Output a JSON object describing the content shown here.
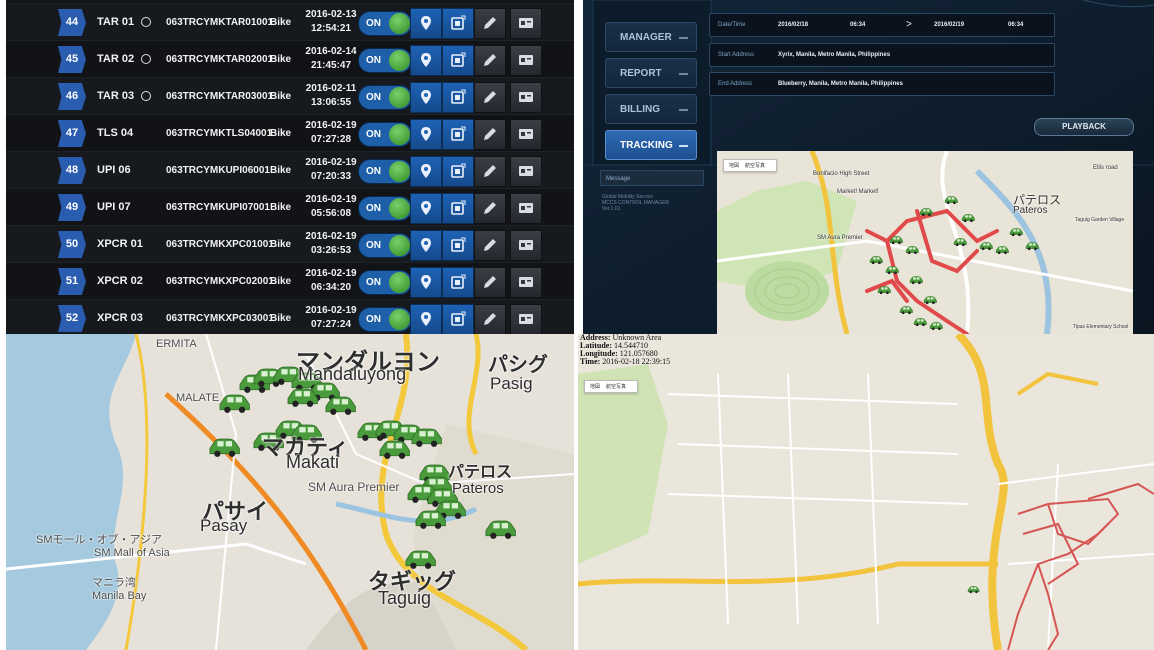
{
  "table": {
    "rows": [
      {
        "index": "44",
        "code": "TAR 01",
        "has_circle": true,
        "imei": "063TRCYMKTAR01001",
        "type": "Bike",
        "date": "2016-02-13",
        "time": "12:54:21",
        "status": "ON"
      },
      {
        "index": "45",
        "code": "TAR 02",
        "has_circle": true,
        "imei": "063TRCYMKTAR02001",
        "type": "Bike",
        "date": "2016-02-14",
        "time": "21:45:47",
        "status": "ON"
      },
      {
        "index": "46",
        "code": "TAR 03",
        "has_circle": true,
        "imei": "063TRCYMKTAR03001",
        "type": "Bike",
        "date": "2016-02-11",
        "time": "13:06:55",
        "status": "ON"
      },
      {
        "index": "47",
        "code": "TLS 04",
        "has_circle": false,
        "imei": "063TRCYMKTLS04001",
        "type": "Bike",
        "date": "2016-02-19",
        "time": "07:27:28",
        "status": "ON"
      },
      {
        "index": "48",
        "code": "UPI 06",
        "has_circle": false,
        "imei": "063TRCYMKUPI06001",
        "type": "Bike",
        "date": "2016-02-19",
        "time": "07:20:33",
        "status": "ON"
      },
      {
        "index": "49",
        "code": "UPI 07",
        "has_circle": false,
        "imei": "063TRCYMKUPI07001",
        "type": "Bike",
        "date": "2016-02-19",
        "time": "05:56:08",
        "status": "ON"
      },
      {
        "index": "50",
        "code": "XPCR 01",
        "has_circle": false,
        "imei": "063TRCYMKXPC01001",
        "type": "Bike",
        "date": "2016-02-19",
        "time": "03:26:53",
        "status": "ON"
      },
      {
        "index": "51",
        "code": "XPCR 02",
        "has_circle": false,
        "imei": "063TRCYMKXPC02001",
        "type": "Bike",
        "date": "2016-02-19",
        "time": "06:34:20",
        "status": "ON"
      },
      {
        "index": "52",
        "code": "XPCR 03",
        "has_circle": false,
        "imei": "063TRCYMKXPC03001",
        "type": "Bike",
        "date": "2016-02-19",
        "time": "07:27:24",
        "status": "ON"
      }
    ],
    "action_icons": [
      "location-pin-icon",
      "device-icon",
      "edit-pencil-icon",
      "card-icon"
    ],
    "colors": {
      "accent": "#2a5db0",
      "toggle_on": "#1d5fa8",
      "knob": "#3da52f"
    }
  },
  "dashboard": {
    "nav": [
      {
        "label": "MANAGER",
        "active": false
      },
      {
        "label": "REPORT",
        "active": false
      },
      {
        "label": "BILLING",
        "active": false
      },
      {
        "label": "TRACKING",
        "active": true
      }
    ],
    "filter": {
      "datetime_label": "Date/Time",
      "from_date": "2016/02/18",
      "from_time": "06:34",
      "arrow": ">",
      "to_date": "2016/02/19",
      "to_time": "06:34",
      "start_label": "Start Address",
      "start_value": "Xyrix, Manila, Metro Manila, Philippines",
      "end_label": "End Address",
      "end_value": "Blueberry, Manila, Metro Manila, Philippines"
    },
    "playback_label": "PLAYBACK",
    "message_label": "Message",
    "message_text": "Global Mobility Service\nMCCS CONTROL MANAGER\nVer.1.01",
    "map": {
      "map_types": [
        "地図",
        "航空写真"
      ],
      "labels": [
        "Bonifacio High Street",
        "Market! Market!",
        "SM Aura Premier",
        "パテロス",
        "Pateros",
        "Ellis road",
        "Tipas Elementary School",
        "Taguig Garden Village"
      ]
    }
  },
  "big_map": {
    "labels": [
      {
        "text": "ERMITA",
        "cls": "small"
      },
      {
        "text": "マンダルヨン",
        "cls": "jp"
      },
      {
        "text": "Mandaluyong",
        "cls": ""
      },
      {
        "text": "パシグ",
        "cls": "jp"
      },
      {
        "text": "Pasig",
        "cls": ""
      },
      {
        "text": "MALATE",
        "cls": "small"
      },
      {
        "text": "マカティ",
        "cls": "jp"
      },
      {
        "text": "Makati",
        "cls": ""
      },
      {
        "text": "パテロス",
        "cls": "jp"
      },
      {
        "text": "Pateros",
        "cls": ""
      },
      {
        "text": "SM Aura Premier",
        "cls": "small"
      },
      {
        "text": "パサイ",
        "cls": "jp"
      },
      {
        "text": "Pasay",
        "cls": ""
      },
      {
        "text": "SMモール・オブ・アジア",
        "cls": "small"
      },
      {
        "text": "SM Mall of Asia",
        "cls": "small"
      },
      {
        "text": "マニラ湾",
        "cls": "small"
      },
      {
        "text": "Manila Bay",
        "cls": "small"
      },
      {
        "text": "タギッグ",
        "cls": "jp"
      },
      {
        "text": "Taguig",
        "cls": ""
      }
    ],
    "car_color": "#4a9b3c",
    "water_color": "#a5c9de"
  },
  "detail_map": {
    "address_label": "Address:",
    "address": "Unknown Area",
    "latitude_label": "Latitude:",
    "latitude": "14.544710",
    "longitude_label": "Longitude:",
    "longitude": "121.057680",
    "time_label": "Time:",
    "time": "2016-02-18 22:39:15",
    "map_types": [
      "地図",
      "航空写真"
    ],
    "route_color": "#d23c3c"
  }
}
